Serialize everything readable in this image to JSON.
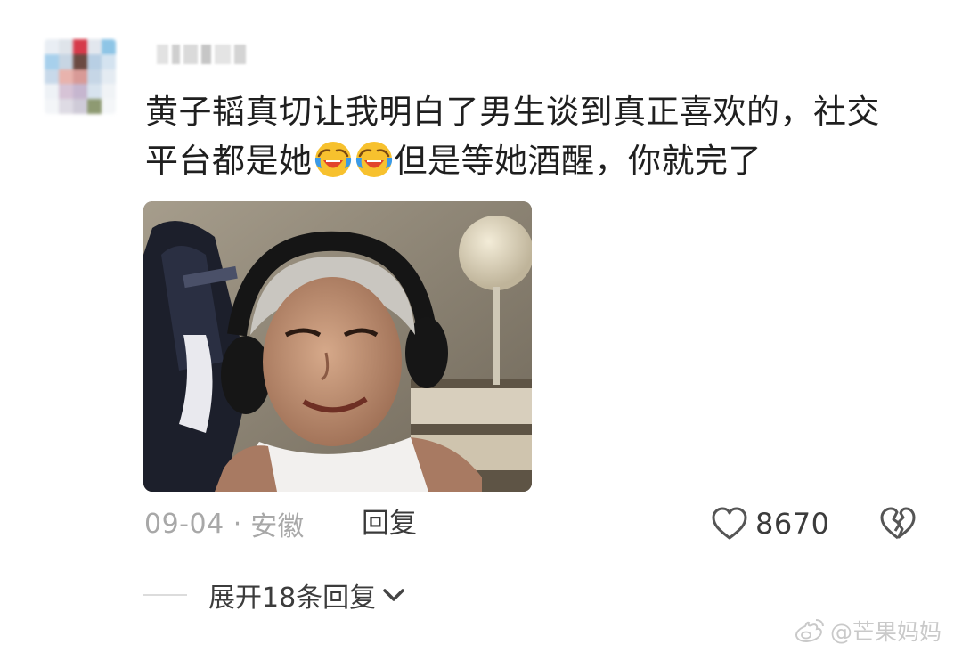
{
  "comment": {
    "text_line1": "黄子韬真切让我明白了男生谈到真正喜欢的，社交",
    "text_line2_before": "平台都是她",
    "text_line2_after": "但是等她酒醒，你就完了",
    "emoji_name": "laughing-crying-emoji"
  },
  "meta": {
    "date": "09-04",
    "separator": "·",
    "location": "安徽",
    "reply_label": "回复"
  },
  "actions": {
    "like_count": "8670",
    "like_icon": "heart-icon",
    "dislike_icon": "broken-heart-icon"
  },
  "replies": {
    "expand_label": "展开18条回复"
  },
  "watermark": {
    "text": "@芒果妈妈"
  },
  "colors": {
    "text_primary": "#1f1f1f",
    "text_meta": "#a8a8a8",
    "text_secondary": "#3c3c3c",
    "watermark": "#c9c9c9"
  }
}
